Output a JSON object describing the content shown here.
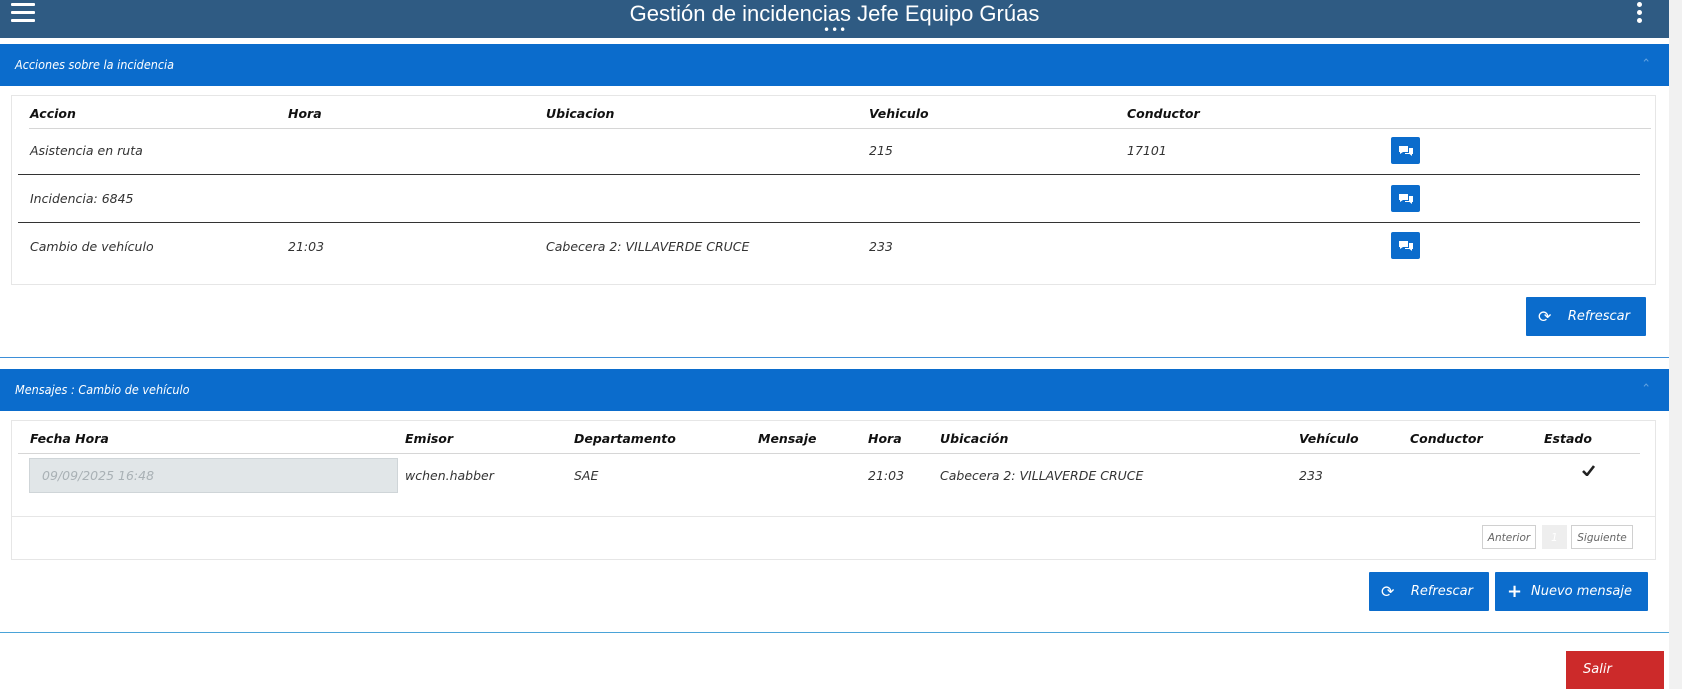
{
  "app": {
    "title": "Gestión de incidencias Jefe Equipo Grúas",
    "dots": "•••"
  },
  "acciones": {
    "header": "Acciones sobre la incidencia",
    "columns": [
      "Accion",
      "Hora",
      "Ubicacion",
      "Vehiculo",
      "Conductor"
    ],
    "rows": [
      {
        "accion": "Asistencia en ruta",
        "hora": "",
        "ubicacion": "",
        "vehiculo": "215",
        "conductor": "17101"
      },
      {
        "accion": "Incidencia: 6845",
        "hora": "",
        "ubicacion": "",
        "vehiculo": "",
        "conductor": ""
      },
      {
        "accion": "Cambio de vehículo",
        "hora": "21:03",
        "ubicacion": "Cabecera 2: VILLAVERDE CRUCE",
        "vehiculo": "233",
        "conductor": ""
      }
    ],
    "refresh_label": "Refrescar"
  },
  "mensajes": {
    "header": "Mensajes : Cambio de vehículo",
    "columns": [
      "Fecha Hora",
      "Emisor",
      "Departamento",
      "Mensaje",
      "Hora",
      "Ubicación",
      "Vehículo",
      "Conductor",
      "Estado"
    ],
    "rows": [
      {
        "fecha_hora": "09/09/2025 16:48",
        "emisor": "wchen.habber",
        "departamento": "SAE",
        "mensaje": "",
        "hora": "21:03",
        "ubicacion": "Cabecera 2: VILLAVERDE CRUCE",
        "vehiculo": "233",
        "conductor": "",
        "estado": "check"
      }
    ],
    "pager": {
      "prev": "Anterior",
      "page": "1",
      "next": "Siguiente"
    },
    "refresh_label": "Refrescar",
    "new_label": "Nuevo mensaje"
  },
  "footer": {
    "exit_label": "Salir"
  },
  "colors": {
    "topbar": "#2f5b83",
    "accent": "#0b6ccc",
    "danger": "#cc2a2a"
  },
  "icons": {
    "menu": "hamburger-icon",
    "more": "kebab-icon",
    "chat": "comments-icon",
    "refresh": "refresh-icon",
    "add": "plus-icon",
    "status": "checkmark-icon"
  }
}
